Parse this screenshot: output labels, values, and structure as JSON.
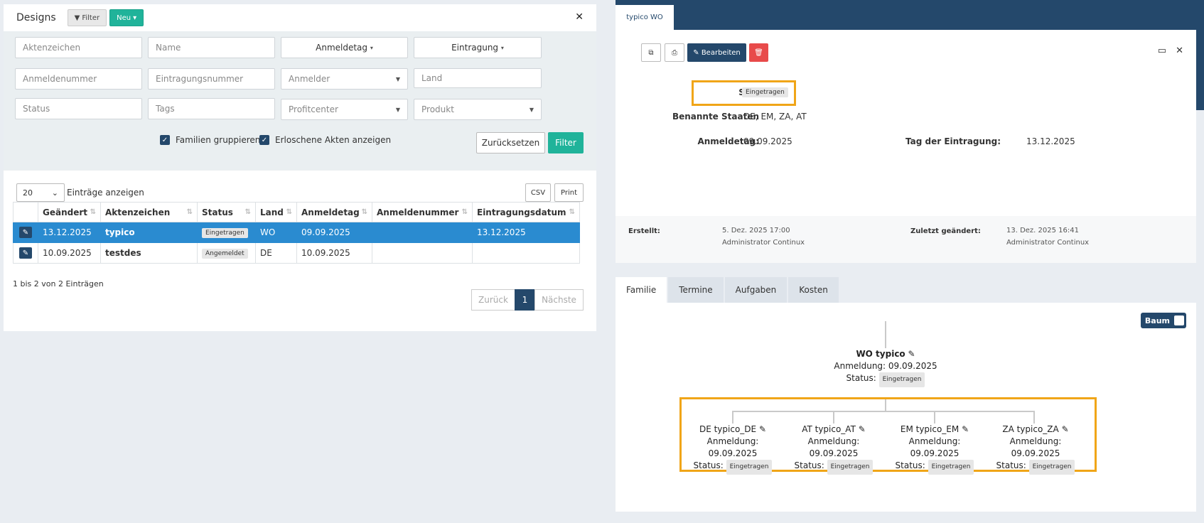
{
  "left": {
    "title": "Designs",
    "filter_btn": "Filter",
    "new_btn": "Neu",
    "filters": {
      "aktenzeichen": "Aktenzeichen",
      "name": "Name",
      "anmeldetag": "Anmeldetag",
      "eintragung": "Eintragung",
      "anmeldenummer": "Anmeldenummer",
      "eintragungsnummer": "Eintragungsnummer",
      "anmelder": "Anmelder",
      "land": "Land",
      "status": "Status",
      "tags": "Tags",
      "profitcenter": "Profitcenter",
      "produkt": "Produkt"
    },
    "check_familien": "Familien gruppieren",
    "check_erloschene": "Erloschene Akten anzeigen",
    "reset_btn": "Zurücksetzen",
    "filter_submit": "Filter",
    "page_length": "20",
    "page_length_label": "Einträge anzeigen",
    "csv": "CSV",
    "print": "Print",
    "columns": [
      "Geändert",
      "Aktenzeichen",
      "Status",
      "Land",
      "Anmeldetag",
      "Anmeldenummer",
      "Eintragungsdatum"
    ],
    "rows": [
      {
        "geaendert": "13.12.2025",
        "akz": "typico",
        "status": "Eingetragen",
        "land": "WO",
        "anmeldetag": "09.09.2025",
        "anmeldenr": "",
        "eintragung": "13.12.2025"
      },
      {
        "geaendert": "10.09.2025",
        "akz": "testdes",
        "status": "Angemeldet",
        "land": "DE",
        "anmeldetag": "10.09.2025",
        "anmeldenr": "",
        "eintragung": ""
      }
    ],
    "info": "1 bis 2 von 2 Einträgen",
    "prev": "Zurück",
    "page": "1",
    "next": "Nächste"
  },
  "right": {
    "tab": "typico WO",
    "edit_btn": "Bearbeiten",
    "status_label": "Status:",
    "status_value": "Eingetragen",
    "staaten_label": "Benannte Staaten",
    "staaten_value": "DE, EM, ZA, AT",
    "anmeldetag_label": "Anmeldetag:",
    "anmeldetag_value": "09.09.2025",
    "eintragung_label": "Tag der Eintragung:",
    "eintragung_value": "13.12.2025",
    "erstellt_label": "Erstellt:",
    "erstellt_date": "5. Dez. 2025 17:00",
    "erstellt_by": "Administrator Continux",
    "geaendert_label": "Zuletzt geändert:",
    "geaendert_date": "13. Dez. 2025 16:41",
    "geaendert_by": "Administrator Continux",
    "tabs": [
      "Familie",
      "Termine",
      "Aufgaben",
      "Kosten"
    ],
    "baum": "Baum",
    "root": {
      "name": "WO typico",
      "anmeldung": "Anmeldung: 09.09.2025",
      "status_label": "Status:",
      "status": "Eingetragen"
    },
    "children": [
      {
        "name": "DE typico_DE",
        "anmeldung": "Anmeldung: 09.09.2025",
        "status_label": "Status:",
        "status": "Eingetragen"
      },
      {
        "name": "AT typico_AT",
        "anmeldung": "Anmeldung: 09.09.2025",
        "status_label": "Status:",
        "status": "Eingetragen"
      },
      {
        "name": "EM typico_EM",
        "anmeldung": "Anmeldung: 09.09.2025",
        "status_label": "Status:",
        "status": "Eingetragen"
      },
      {
        "name": "ZA typico_ZA",
        "anmeldung": "Anmeldung: 09.09.2025",
        "status_label": "Status:",
        "status": "Eingetragen"
      }
    ]
  },
  "colors": {
    "navy": "#24486b",
    "teal": "#20b39a",
    "highlight": "#f0a518",
    "selected_row": "#2a8bd0",
    "danger": "#e84a4a"
  }
}
